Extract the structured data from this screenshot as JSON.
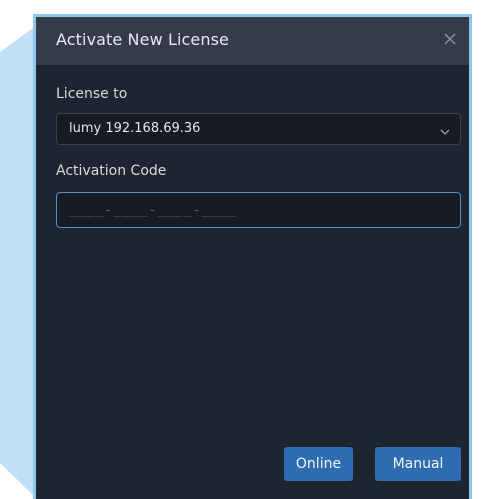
{
  "dialog": {
    "title": "Activate New License",
    "close_icon": "close-icon"
  },
  "license": {
    "label": "License to",
    "selected_value": "lumy 192.168.69.36",
    "dropdown_icon": "chevron-down-icon"
  },
  "activation": {
    "label": "Activation Code",
    "placeholder": "____-____-____-____"
  },
  "buttons": {
    "online_label": "Online",
    "manual_label": "Manual"
  },
  "colors": {
    "dialog_bg": "#1f2530",
    "titlebar_bg": "#353b4a",
    "accent_button": "#2f6db0",
    "focus_border": "#4e8fd1",
    "frame_border": "#8ec8ef"
  }
}
